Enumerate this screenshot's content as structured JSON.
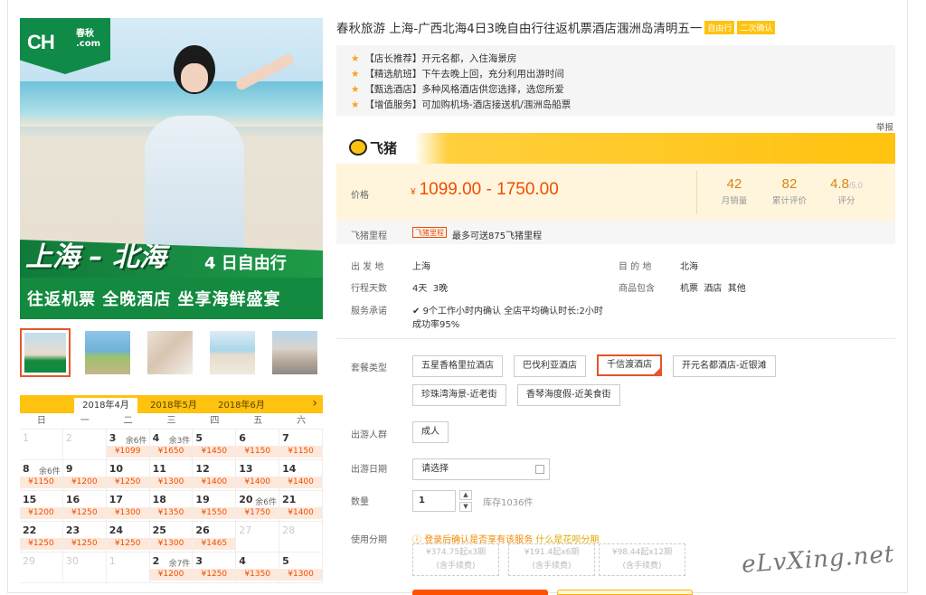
{
  "gallery": {
    "logo_text": "CH",
    "logo_sub1": "春秋",
    "logo_sub2": ".com",
    "banner_main": "上海 – 北海",
    "banner_sub": "4 日自由行",
    "banner_line2": "往返机票 全晚酒店 坐享海鲜盛宴"
  },
  "calendar": {
    "tabs": [
      "2018年4月",
      "2018年5月",
      "2018年6月"
    ],
    "active_tab": 0,
    "next_icon": "chevron-right-icon",
    "weekdays": [
      "日",
      "一",
      "二",
      "三",
      "四",
      "五",
      "六"
    ],
    "cells": [
      {
        "d": "1",
        "off": true
      },
      {
        "d": "2",
        "off": true
      },
      {
        "d": "3",
        "r": "余6件",
        "p": "¥1099"
      },
      {
        "d": "4",
        "r": "余3件",
        "p": "¥1650"
      },
      {
        "d": "5",
        "p": "¥1450"
      },
      {
        "d": "6",
        "p": "¥1150"
      },
      {
        "d": "7",
        "p": "¥1150"
      },
      {
        "d": "8",
        "r": "余6件",
        "p": "¥1150"
      },
      {
        "d": "9",
        "p": "¥1200"
      },
      {
        "d": "10",
        "p": "¥1250"
      },
      {
        "d": "11",
        "p": "¥1300"
      },
      {
        "d": "12",
        "p": "¥1400"
      },
      {
        "d": "13",
        "p": "¥1400"
      },
      {
        "d": "14",
        "p": "¥1400"
      },
      {
        "d": "15",
        "p": "¥1200"
      },
      {
        "d": "16",
        "p": "¥1250"
      },
      {
        "d": "17",
        "p": "¥1300"
      },
      {
        "d": "18",
        "p": "¥1350"
      },
      {
        "d": "19",
        "p": "¥1550"
      },
      {
        "d": "20",
        "r": "余6件",
        "p": "¥1750"
      },
      {
        "d": "21",
        "p": "¥1400"
      },
      {
        "d": "22",
        "p": "¥1250"
      },
      {
        "d": "23",
        "p": "¥1250"
      },
      {
        "d": "24",
        "p": "¥1250"
      },
      {
        "d": "25",
        "p": "¥1300"
      },
      {
        "d": "26",
        "p": "¥1465"
      },
      {
        "d": "27",
        "off": true
      },
      {
        "d": "28",
        "off": true
      },
      {
        "d": "29",
        "off": true
      },
      {
        "d": "30",
        "off": true
      },
      {
        "d": "1",
        "off": true
      },
      {
        "d": "2",
        "r": "余7件",
        "p": "¥1200"
      },
      {
        "d": "3",
        "p": "¥1250"
      },
      {
        "d": "4",
        "p": "¥1350"
      },
      {
        "d": "5",
        "p": "¥1300"
      }
    ]
  },
  "product": {
    "title": "春秋旅游 上海-广西北海4日3晚自由行往返机票酒店涠洲岛清明五一",
    "tags": [
      "自由行",
      "二次确认"
    ],
    "features": [
      "【店长推荐】开元名都，入住海景房",
      "【精选航班】下午去晚上回，充分利用出游时间",
      "【甄选酒店】多种风格酒店供您选择，选您所爱",
      "【增值服务】可加购机场-酒店接送机/涠洲岛船票"
    ],
    "report": "举报",
    "brand": "飞猪",
    "price_label": "价格",
    "price_symbol": "¥",
    "price": "1099.00 - 1750.00",
    "stats": [
      {
        "n": "42",
        "l": "月销量"
      },
      {
        "n": "82",
        "l": "累计评价"
      },
      {
        "n": "4.8",
        "suffix": "/5.0",
        "l": "评分"
      }
    ],
    "miles_label": "飞猪里程",
    "miles_badge": "飞猪里程",
    "miles_text": "最多可送875飞猪里程",
    "info": {
      "from_label": "出 发 地",
      "from": "上海",
      "to_label": "目 的 地",
      "to": "北海",
      "days_label": "行程天数",
      "days": "4天  3晚",
      "includes_label": "商品包含",
      "includes": "机票  酒店  其他",
      "promise_label": "服务承诺",
      "promise_1": "9个工作小时内确认 全店平均确认时长:2小时",
      "promise_2": "成功率95%"
    },
    "package_label": "套餐类型",
    "packages": [
      "五星香格里拉酒店",
      "巴伐利亚酒店",
      "千信渡酒店",
      "开元名都酒店-近银滩",
      "珍珠湾海景-近老街",
      "香琴海度假-近美食街"
    ],
    "selected_package": "千信渡酒店",
    "crowd_label": "出游人群",
    "crowd": "成人",
    "date_label": "出游日期",
    "date_placeholder": "请选择",
    "qty_label": "数量",
    "qty": "1",
    "stock": "库存1036件",
    "install_label": "使用分期",
    "install_tip": "登录后确认是否享有该服务",
    "install_link": "什么是花呗分期",
    "installments": [
      {
        "a": "¥374.75起x3期",
        "b": "(含手续费)"
      },
      {
        "a": "¥191.4起x6期",
        "b": "(含手续费)"
      },
      {
        "a": "¥98.44起x12期",
        "b": "(含手续费)"
      }
    ]
  },
  "watermark": "eLvXing.net",
  "colors": {
    "accent": "#ffc20e",
    "price": "#f04d00",
    "brand_green": "#0f8a47"
  }
}
